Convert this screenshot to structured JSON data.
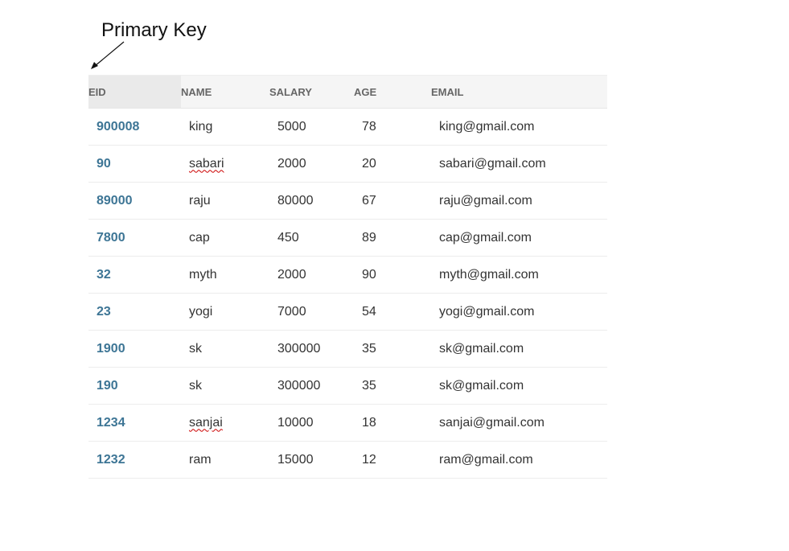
{
  "annotation": {
    "label": "Primary Key"
  },
  "table": {
    "columns": [
      "EID",
      "NAME",
      "SALARY",
      "AGE",
      "EMAIL"
    ],
    "rows": [
      {
        "eid": "900008",
        "name": "king",
        "salary": "5000",
        "age": "78",
        "email": "king@gmail.com"
      },
      {
        "eid": "90",
        "name": "sabari",
        "salary": "2000",
        "age": "20",
        "email": "sabari@gmail.com"
      },
      {
        "eid": "89000",
        "name": "raju",
        "salary": "80000",
        "age": "67",
        "email": "raju@gmail.com"
      },
      {
        "eid": "7800",
        "name": "cap",
        "salary": "450",
        "age": "89",
        "email": "cap@gmail.com"
      },
      {
        "eid": "32",
        "name": "myth",
        "salary": "2000",
        "age": "90",
        "email": "myth@gmail.com"
      },
      {
        "eid": "23",
        "name": "yogi",
        "salary": "7000",
        "age": "54",
        "email": "yogi@gmail.com"
      },
      {
        "eid": "1900",
        "name": "sk",
        "salary": "300000",
        "age": "35",
        "email": "sk@gmail.com"
      },
      {
        "eid": "190",
        "name": "sk",
        "salary": "300000",
        "age": "35",
        "email": "sk@gmail.com"
      },
      {
        "eid": "1234",
        "name": "sanjai",
        "salary": "10000",
        "age": "18",
        "email": "sanjai@gmail.com"
      },
      {
        "eid": "1232",
        "name": "ram",
        "salary": "15000",
        "age": "12",
        "email": "ram@gmail.com"
      }
    ]
  },
  "colors": {
    "eid_text": "#3d7595",
    "header_bg": "#f5f5f5",
    "header_text": "#666666",
    "spellcheck_underline": "#cc0000"
  }
}
